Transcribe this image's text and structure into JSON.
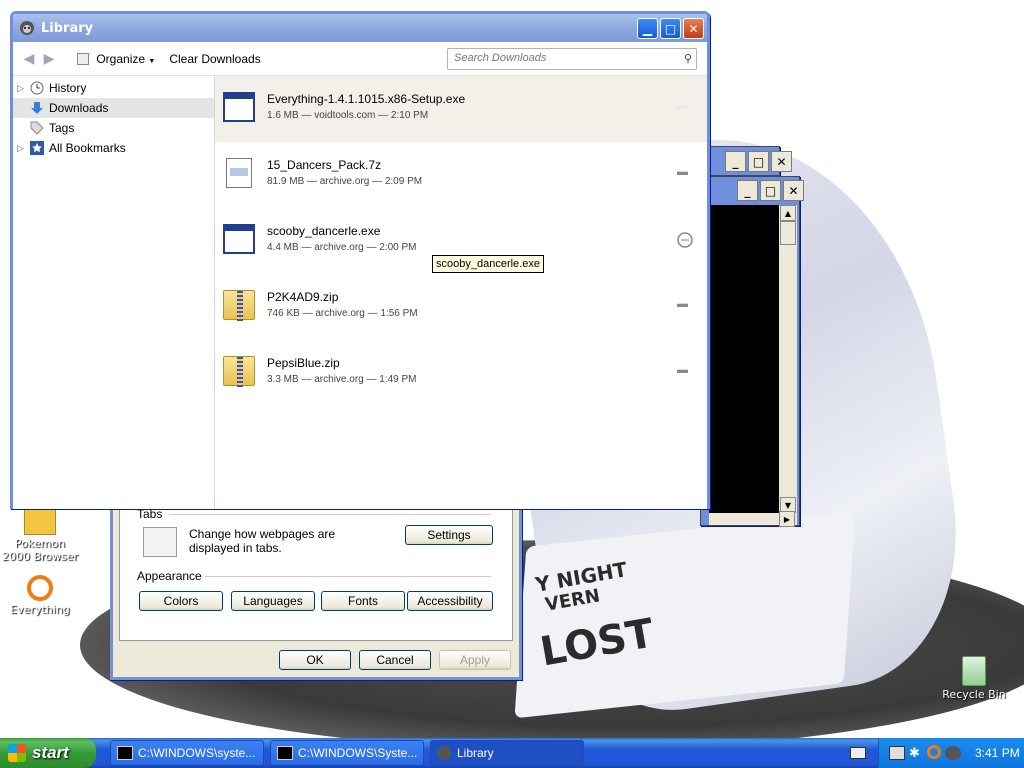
{
  "desktop": {
    "icons": [
      {
        "label": "Pokemon 2000 Browser"
      },
      {
        "label": "Everything"
      },
      {
        "label": "Recycle Bin"
      }
    ],
    "hat_text": [
      "Y NIGHT",
      "VERN",
      "LOST"
    ]
  },
  "library": {
    "title": "Library",
    "toolbar": {
      "organize_label": "Organize",
      "clear_downloads_label": "Clear Downloads",
      "search_placeholder": "Search Downloads"
    },
    "sidebar": {
      "items": [
        {
          "label": "History",
          "icon": "clock-icon"
        },
        {
          "label": "Downloads",
          "icon": "download-arrow-icon",
          "selected": true
        },
        {
          "label": "Tags",
          "icon": "tag-icon"
        },
        {
          "label": "All Bookmarks",
          "icon": "star-icon"
        }
      ]
    },
    "downloads": [
      {
        "name": "Everything-1.4.1.1015.x86-Setup.exe",
        "meta": "1.6 MB — voidtools.com — 2:10 PM",
        "icon": "exe-icon"
      },
      {
        "name": "15_Dancers_Pack.7z",
        "meta": "81.9 MB — archive.org — 2:09 PM",
        "icon": "archive-file-icon"
      },
      {
        "name": "scooby_dancerle.exe",
        "meta": "4.4 MB — archive.org — 2:00 PM",
        "icon": "exe-icon"
      },
      {
        "name": "P2K4AD9.zip",
        "meta": "746 KB — archive.org — 1:56 PM",
        "icon": "zip-folder-icon"
      },
      {
        "name": "PepsiBlue.zip",
        "meta": "3.3 MB — archive.org — 1:49 PM",
        "icon": "zip-folder-icon"
      }
    ],
    "tooltip": "scooby_dancerle.exe"
  },
  "options": {
    "tabs_label": "Tabs",
    "tabs_desc": "Change how webpages are displayed in tabs.",
    "settings_label": "Settings",
    "appearance_label": "Appearance",
    "appearance_buttons": [
      "Colors",
      "Languages",
      "Fonts",
      "Accessibility"
    ],
    "ok_label": "OK",
    "cancel_label": "Cancel",
    "apply_label": "Apply"
  },
  "taskbar": {
    "start_label": "start",
    "tasks": [
      {
        "label": "C:\\WINDOWS\\syste..."
      },
      {
        "label": "C:\\WINDOWS\\Syste..."
      },
      {
        "label": "Library"
      }
    ],
    "clock": "3:41 PM"
  }
}
